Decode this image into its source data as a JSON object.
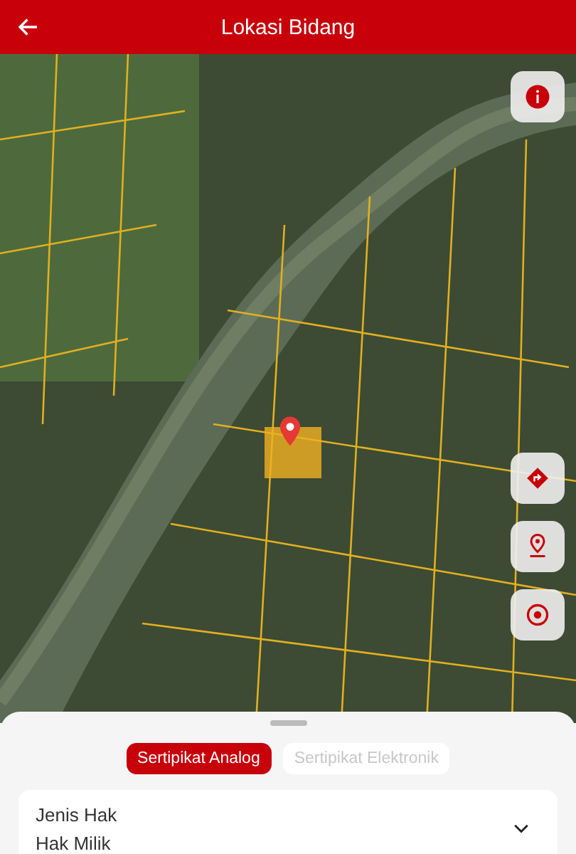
{
  "header": {
    "title": "Lokasi Bidang"
  },
  "map_controls": [
    {
      "kind": "info"
    },
    {
      "kind": "direction"
    },
    {
      "kind": "pin"
    },
    {
      "kind": "target"
    }
  ],
  "tabs": [
    {
      "label": "Sertipikat Analog",
      "selected": true
    },
    {
      "label": "Sertipikat Elektronik",
      "selected": false
    }
  ],
  "fields": [
    {
      "label": "Jenis Hak",
      "value": "Hak Milik",
      "expanded": false
    }
  ]
}
